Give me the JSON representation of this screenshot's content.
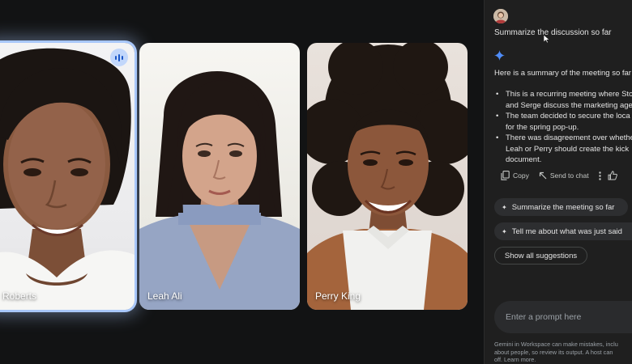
{
  "participants": [
    {
      "name": "Roberts",
      "speaking": true
    },
    {
      "name": "Leah Ali",
      "speaking": false
    },
    {
      "name": "Perry King",
      "speaking": false
    }
  ],
  "gemini": {
    "user_prompt": "Summarize the discussion so far",
    "summary_intro": "Here is a summary of the meeting so far",
    "bullets": [
      [
        "This is a recurring meeting where Sto",
        "and Serge discuss the marketing age"
      ],
      [
        "The team decided to secure the loca",
        "for the spring pop-up."
      ],
      [
        "There was disagreement over whethe",
        "Leah or Perry should create the kick",
        "document."
      ]
    ],
    "actions": {
      "copy": "Copy",
      "send_to_chat": "Send to chat"
    },
    "suggestions": [
      "Summarize the meeting so far",
      "Tell me about what was just said"
    ],
    "show_all": "Show all suggestions",
    "prompt_placeholder": "Enter a prompt here",
    "disclaimer_lines": [
      "Gemini in Workspace can make mistakes, inclu",
      "about people, so review its output. A host can",
      "off. Learn more."
    ]
  },
  "colors": {
    "accent": "#a8c7fa",
    "stage_bg": "#121314",
    "panel_bg": "#1f1f1f",
    "gemini_blue": "#4f8cf7"
  },
  "icons": [
    "user-avatar",
    "mouse-cursor-icon",
    "gemini-spark-icon",
    "copy-icon",
    "send-to-chat-icon",
    "more-vert-icon",
    "thumb-up-icon",
    "speaking-indicator-icon"
  ]
}
